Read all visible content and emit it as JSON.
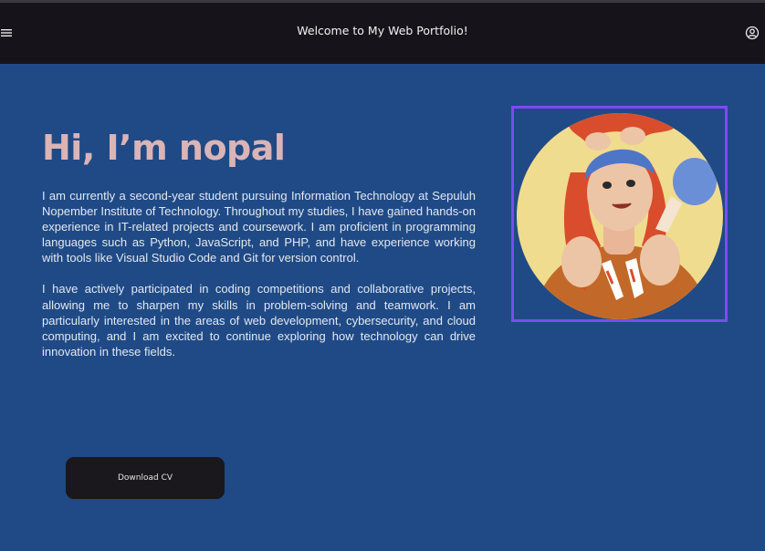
{
  "header": {
    "title": "Welcome to My Web Portfolio!",
    "menu_icon": "hamburger-menu-icon",
    "user_icon": "user-circle-icon"
  },
  "hero": {
    "heading": "Hi, I’m nopal",
    "paragraphs": [
      "I am currently a second-year student pursuing Information Technology at Sepuluh Nopember Institute of Technology. Throughout my studies, I have gained hands-on experience in IT-related projects and coursework. I am proficient in programming languages such as Python, JavaScript, and PHP, and have experience working with tools like Visual Studio Code and Git for version control.",
      "I have actively participated in coding competitions and collaborative projects, allowing me to sharpen my skills in problem-solving and teamwork. I am particularly interested in the areas of web development, cybersecurity, and cloud computing, and I am excited to continue exploring how technology can drive innovation in these fields."
    ],
    "cv_button": "Download CV"
  },
  "colors": {
    "page_bg": "#1f4a86",
    "navbar_bg": "#16141a",
    "heading": "#dbb4b6",
    "frame": "#7b4cf0",
    "button_bg": "#1a181c"
  }
}
